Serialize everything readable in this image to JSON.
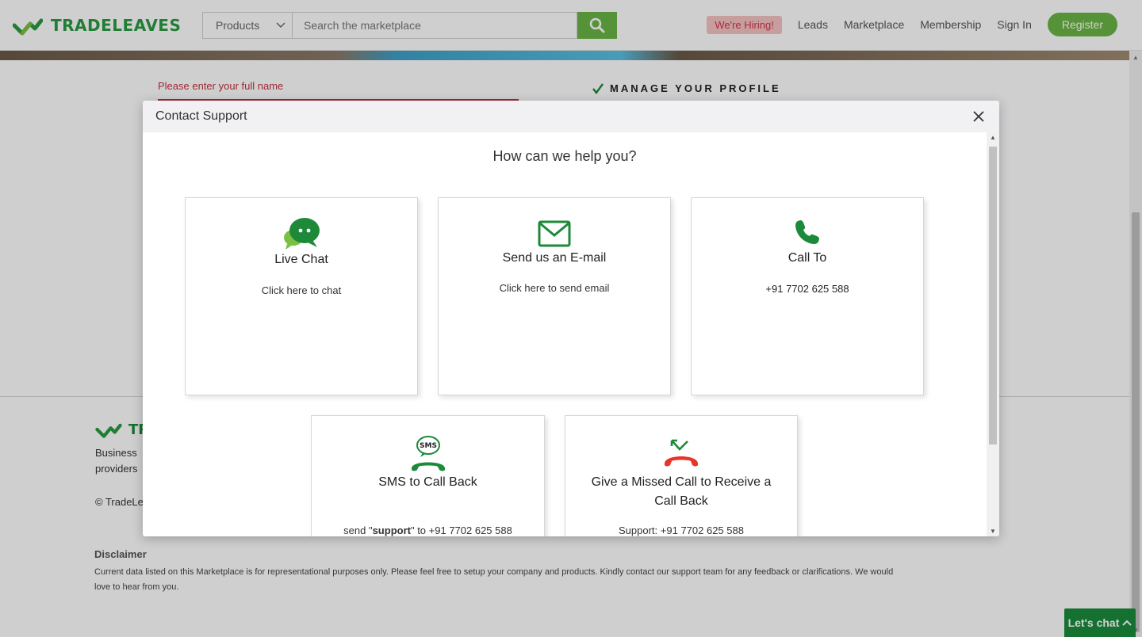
{
  "header": {
    "logo_text": "TRADELEAVES",
    "category_select": "Products",
    "search_placeholder": "Search the marketplace",
    "hiring_badge": "We're Hiring!",
    "nav": [
      "Leads",
      "Marketplace",
      "Membership",
      "Sign In"
    ],
    "register_label": "Register"
  },
  "page": {
    "form_error": "Please enter your full name",
    "manage_profile": "MANAGE YOUR PROFILE",
    "footer_logo": "TR",
    "footer_desc": "Business providers",
    "footer_copy": "© TradeLe",
    "disclaimer_heading": "Disclaimer",
    "disclaimer_text": "Current data listed on this Marketplace is for representational purposes only. Please feel free to setup your company and products. Kindly contact our support team for any feedback or clarifications. We would love to hear from you.",
    "lets_chat": "Let's chat"
  },
  "modal": {
    "title": "Contact Support",
    "heading": "How can we help you?",
    "cards": [
      {
        "icon": "chat-bubbles-icon",
        "title": "Live Chat",
        "subtitle": "Click here to chat"
      },
      {
        "icon": "envelope-icon",
        "title": "Send us an E-mail",
        "subtitle": "Click here to send email"
      },
      {
        "icon": "phone-icon",
        "title": "Call To",
        "subtitle": "+91 7702 625 588"
      },
      {
        "icon": "sms-callback-icon",
        "title": "SMS to Call Back",
        "subtitle_prefix": "send \"",
        "subtitle_bold": "support",
        "subtitle_mid": "\" to ",
        "subtitle_number": "+91 7702 625 588"
      },
      {
        "icon": "missed-call-icon",
        "title": "Give a Missed Call to Receive a Call Back",
        "subtitle_prefix": "Support: ",
        "subtitle_number": "+91 7702 625 588"
      }
    ]
  },
  "colors": {
    "brand_green": "#1d8a3a",
    "accent_green": "#6bb444",
    "error_red": "#c4303e",
    "missed_call_red": "#e8352a"
  }
}
